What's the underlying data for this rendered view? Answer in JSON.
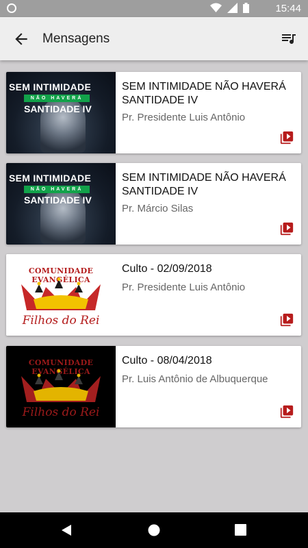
{
  "status_bar": {
    "time": "15:44"
  },
  "app_bar": {
    "title": "Mensagens"
  },
  "thumb_text": {
    "sem": {
      "line1": "SEM INTIMIDADE",
      "line2": "NÃO HAVERÁ",
      "line3": "SANTIDADE IV"
    },
    "logo": {
      "top": "COMUNIDADE EVANGÉLICA",
      "bottom": "Filhos do Rei"
    }
  },
  "items": [
    {
      "title": "SEM INTIMIDADE NÃO HAVERÁ SANTIDADE IV",
      "speaker": "Pr. Presidente Luis Antônio"
    },
    {
      "title": "SEM INTIMIDADE NÃO HAVERÁ SANTIDADE IV",
      "speaker": "Pr. Márcio Silas"
    },
    {
      "title": "Culto - 02/09/2018",
      "speaker": "Pr. Presidente Luis Antônio"
    },
    {
      "title": "Culto - 08/04/2018",
      "speaker": "Pr. Luis Antônio de Albuquerque"
    }
  ],
  "colors": {
    "accent": "#b71c1c",
    "status_bar": "#9e9e9e",
    "app_bar": "#eeeeee",
    "background": "#cfcdcf"
  },
  "icons": [
    "back-arrow-icon",
    "playlist-icon",
    "play-video-icon"
  ]
}
